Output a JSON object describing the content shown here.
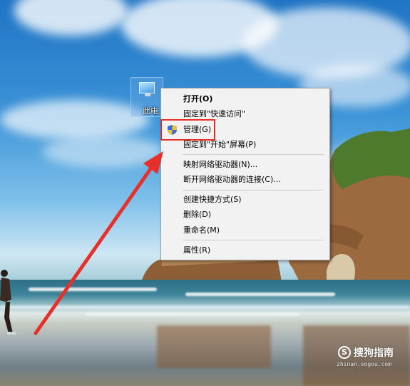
{
  "desktop": {
    "icon": {
      "label": "此电",
      "icon": "computer-icon"
    }
  },
  "context_menu": {
    "items": [
      {
        "label": "打开(O)",
        "bold": true
      },
      {
        "label": "固定到\"快速访问\""
      },
      {
        "label": "管理(G)",
        "icon": "uac-shield-icon"
      },
      {
        "label": "固定到\"开始\"屏幕(P)"
      },
      {
        "label": "映射网络驱动器(N)..."
      },
      {
        "label": "断开网络驱动器的连接(C)..."
      },
      {
        "label": "创建快捷方式(S)"
      },
      {
        "label": "删除(D)"
      },
      {
        "label": "重命名(M)"
      },
      {
        "label": "属性(R)"
      }
    ]
  },
  "annotation": {
    "color": "#e8302a"
  },
  "watermark": {
    "name": "搜狗指南",
    "url": "zhinan.sogou.com",
    "logo": "S"
  },
  "colors": {
    "menu_bg": "#f2f2f2",
    "menu_border": "#a0a0a0",
    "highlight": "#e8302a"
  }
}
